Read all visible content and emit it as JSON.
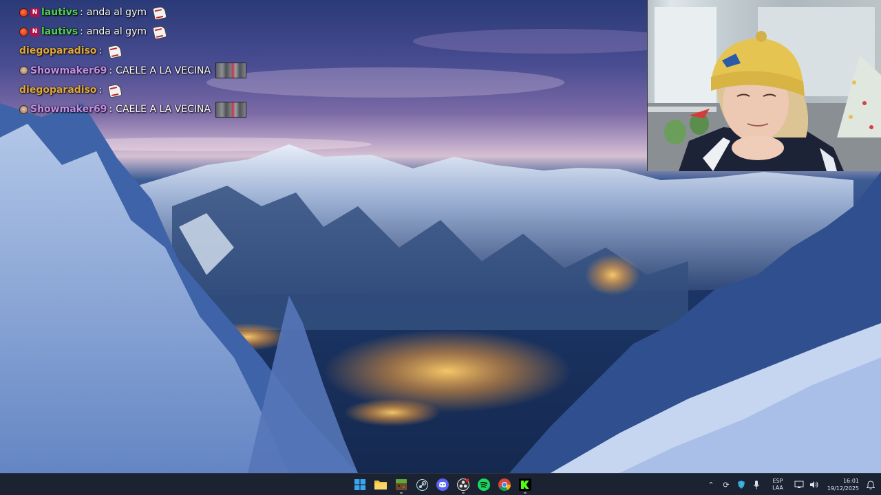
{
  "chat": {
    "messages": [
      {
        "badges": [
          "red-circle-badge",
          "n-badge"
        ],
        "user": "lautivs",
        "user_color": "#52d152",
        "text": "anda al gym",
        "emote": "santa-hat-emote"
      },
      {
        "badges": [
          "red-circle-badge",
          "n-badge"
        ],
        "user": "lautivs",
        "user_color": "#52d152",
        "text": "anda al gym",
        "emote": "santa-hat-emote"
      },
      {
        "badges": [],
        "user": "diegoparadiso",
        "user_color": "#e2a93a",
        "text": "",
        "emote": "santa-hat-emote"
      },
      {
        "badges": [
          "skull-badge"
        ],
        "user": "Showmaker69",
        "user_color": "#c58ee8",
        "text": "CAELE A LA VECINA",
        "emote": "group-photo-emote"
      },
      {
        "badges": [],
        "user": "diegoparadiso",
        "user_color": "#e2a93a",
        "text": "",
        "emote": "santa-hat-emote"
      },
      {
        "badges": [
          "skull-badge"
        ],
        "user": "Showmaker69",
        "user_color": "#c58ee8",
        "text": "CAELE A LA VECINA",
        "emote": "group-photo-emote"
      }
    ]
  },
  "taskbar": {
    "pinned": [
      {
        "name": "windows-start",
        "running": false
      },
      {
        "name": "file-explorer",
        "running": false
      },
      {
        "name": "minecraft",
        "running": true
      },
      {
        "name": "steam",
        "running": false
      },
      {
        "name": "discord",
        "running": false
      },
      {
        "name": "obs",
        "running": true
      },
      {
        "name": "spotify",
        "running": false
      },
      {
        "name": "chrome",
        "running": false
      },
      {
        "name": "kick",
        "running": true
      }
    ],
    "tray": {
      "lang_line1": "ESP",
      "lang_line2": "LAA",
      "time": "16:01",
      "date": "19/12/2025"
    }
  },
  "colors": {
    "taskbar_bg": "#1b2332",
    "kick_green": "#53fc18",
    "spotify_green": "#1ed760",
    "discord_blurple": "#5865f2"
  }
}
